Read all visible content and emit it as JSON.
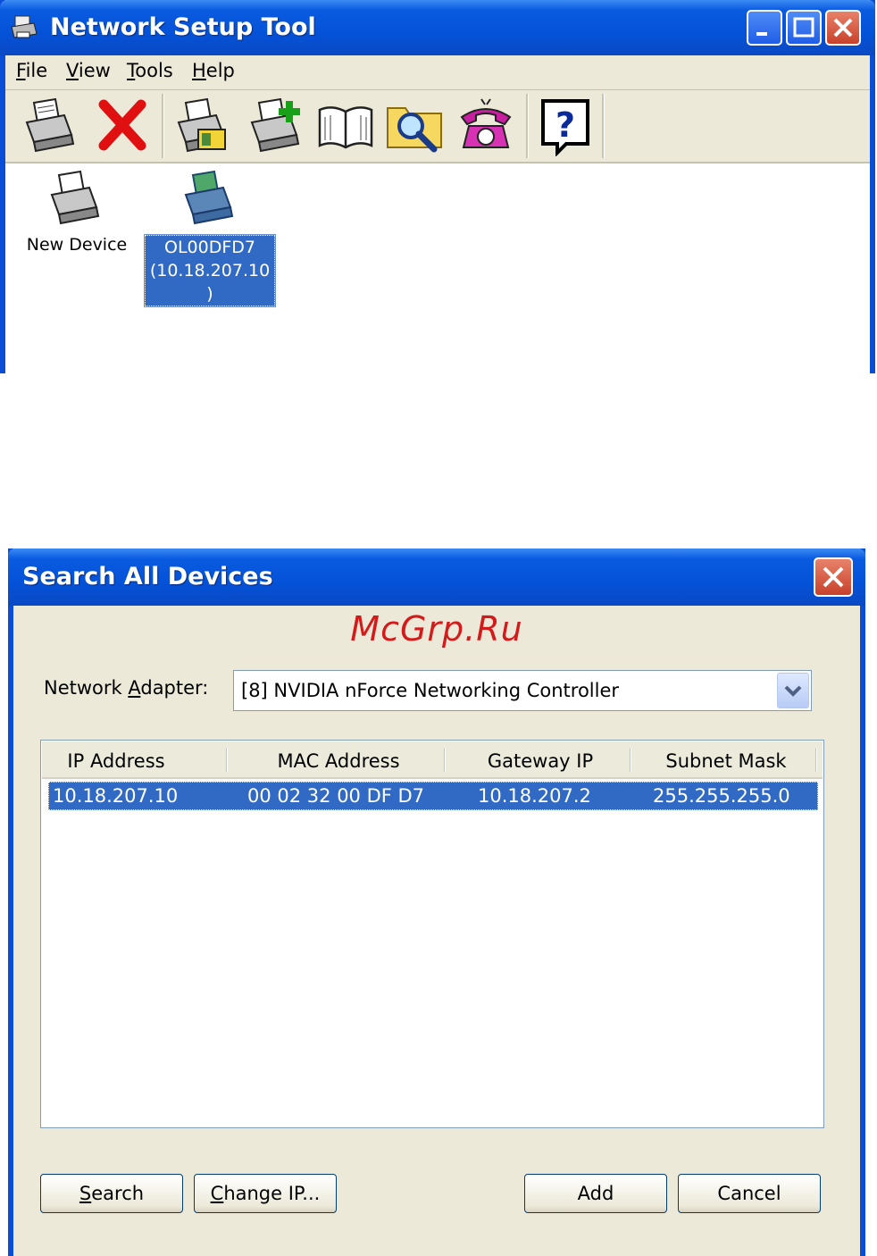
{
  "window1": {
    "title": "Network Setup Tool",
    "menu": [
      {
        "label": "File",
        "key": "F",
        "rest": "ile"
      },
      {
        "label": "View",
        "key": "V",
        "rest": "iew"
      },
      {
        "label": "Tools",
        "key": "T",
        "rest": "ools"
      },
      {
        "label": "Help",
        "key": "H",
        "rest": "elp"
      }
    ],
    "toolbar": [
      "new-device-icon",
      "delete-icon",
      "configure-device-icon",
      "add-device-icon",
      "book-icon",
      "search-folder-icon",
      "phone-icon",
      "help-icon"
    ],
    "devices": [
      {
        "label": "New Device",
        "selected": false
      },
      {
        "label_lines": [
          "OL00DFD7",
          "(10.18.207.10",
          ")"
        ],
        "selected": true
      }
    ]
  },
  "dialog": {
    "title": "Search All Devices",
    "watermark": "McGrp.Ru",
    "adapter_label_key": "A",
    "adapter_label_pre": "Network ",
    "adapter_label_post": "dapter:",
    "adapter_value": "[8] NVIDIA nForce Networking Controller",
    "columns": [
      "IP Address",
      "MAC Address",
      "Gateway IP",
      "Subnet Mask"
    ],
    "rows": [
      {
        "ip": "10.18.207.10",
        "mac": "00 02 32 00 DF D7",
        "gateway": "10.18.207.2",
        "mask": "255.255.255.0"
      }
    ],
    "buttons": {
      "search_key": "S",
      "search_rest": "earch",
      "change_key": "C",
      "change_rest": "hange IP...",
      "add": "Add",
      "cancel": "Cancel"
    }
  },
  "colors": {
    "titlebar": "#0a5be0",
    "selection": "#316ac5",
    "window_bg": "#ece9d8",
    "watermark": "#d41b1b"
  }
}
